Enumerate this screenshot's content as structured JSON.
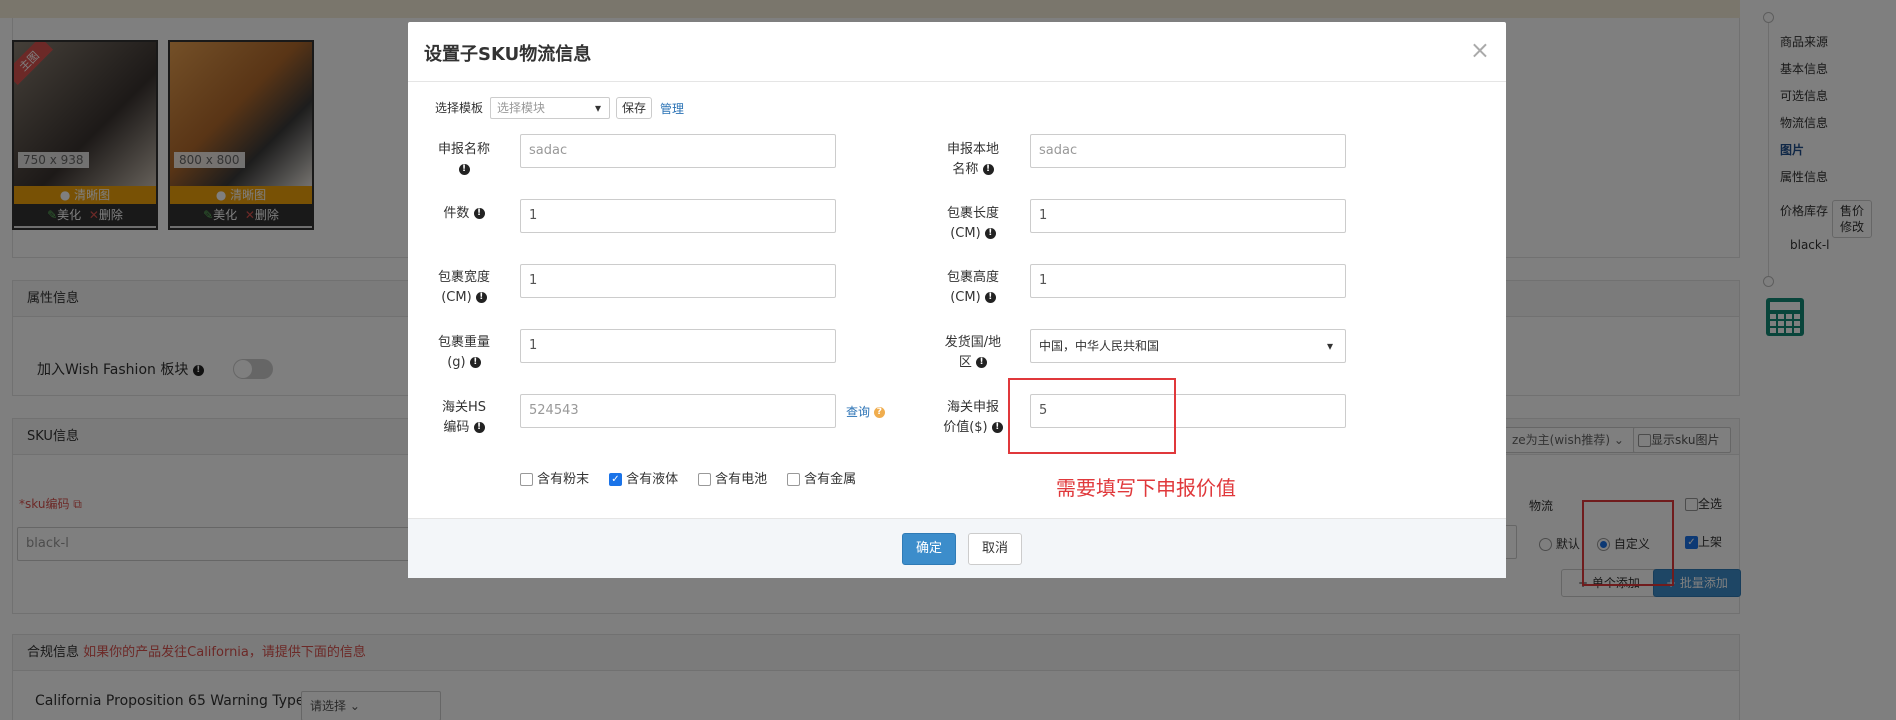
{
  "background": {
    "images": [
      {
        "size": "750 x 938",
        "clear_label": "清晰图",
        "beautify": "美化",
        "delete": "删除",
        "main_badge": "主图"
      },
      {
        "size": "800 x 800",
        "clear_label": "清晰图",
        "beautify": "美化",
        "delete": "删除"
      }
    ],
    "attr_panel": {
      "title": "属性信息",
      "wish_fashion": "加入Wish Fashion 板块"
    },
    "sku_panel": {
      "title": "SKU信息",
      "sku_code_label": "*sku编码",
      "sku_value": "black-l",
      "size_select": "ze为主(wish推荐)",
      "show_sku_img": "显示sku图片",
      "logistics": "物流",
      "select_all": "全选",
      "default": "默认",
      "custom": "自定义",
      "on_shelf": "上架",
      "single_add": "单个添加",
      "batch_add": "批量添加"
    },
    "compliance_panel": {
      "title": "合规信息",
      "hint": "如果你的产品发往California，请提供下面的信息",
      "prop65_label": "California Proposition 65 Warning Type",
      "prop65_select": "请选择"
    },
    "side_nav": {
      "items": [
        "商品来源",
        "基本信息",
        "可选信息",
        "物流信息",
        "图片",
        "属性信息",
        "价格库存",
        "black-l"
      ],
      "active": "图片",
      "price_btn": "售价修改"
    }
  },
  "modal": {
    "title": "设置子SKU物流信息",
    "template": {
      "label": "选择模板",
      "placeholder": "选择模块",
      "save": "保存",
      "manage": "管理"
    },
    "fields": {
      "declare_name": {
        "label": "申报名称",
        "value": "sadac"
      },
      "declare_local_name": {
        "label": "申报本地名称",
        "value": "sadac"
      },
      "quantity": {
        "label": "件数",
        "value": "1"
      },
      "pkg_length": {
        "label": "包裹长度(CM)",
        "value": "1"
      },
      "pkg_width": {
        "label": "包裹宽度(CM)",
        "value": "1"
      },
      "pkg_height": {
        "label": "包裹高度(CM)",
        "value": "1"
      },
      "pkg_weight": {
        "label": "包裹重量(g)",
        "value": "1"
      },
      "ship_country": {
        "label": "发货国/地区",
        "value": "中国，中华人民共和国"
      },
      "hs_code": {
        "label": "海关HS编码",
        "value": "524543",
        "query": "查询"
      },
      "declare_value": {
        "label": "海关申报价值($)",
        "value": "5"
      }
    },
    "checkboxes": [
      {
        "label": "含有粉末",
        "checked": false
      },
      {
        "label": "含有液体",
        "checked": true
      },
      {
        "label": "含有电池",
        "checked": false
      },
      {
        "label": "含有金属",
        "checked": false
      }
    ],
    "confirm": "确定",
    "cancel": "取消"
  },
  "annotation": {
    "note": "需要填写下申报价值"
  },
  "colors": {
    "accent": "#3c8dcb",
    "annotation": "#e0383b",
    "active_nav": "#1f4e8c"
  }
}
